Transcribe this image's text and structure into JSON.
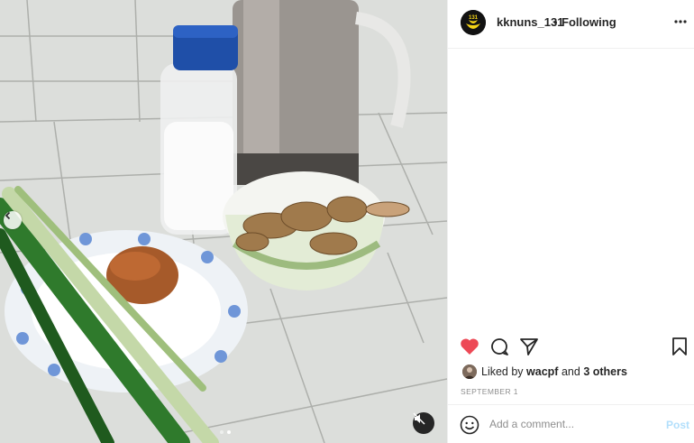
{
  "post": {
    "username": "kknuns_131",
    "separator": "•",
    "follow_status": "Following",
    "avatar_text": "131",
    "liked_by_prefix": "Liked by",
    "liked_by_user": "wacpf",
    "liked_by_and": "and",
    "liked_by_others": "3 others",
    "date": "SEPTEMBER 1",
    "liked": true
  },
  "comment": {
    "placeholder": "Add a comment...",
    "post_label": "Post"
  },
  "media": {
    "type": "video",
    "muted": true,
    "carousel_count": 2,
    "carousel_index": 1
  },
  "colors": {
    "like_red": "#ed4956",
    "post_disabled": "#b2dffc",
    "avatar_yellow": "#f5d416"
  }
}
